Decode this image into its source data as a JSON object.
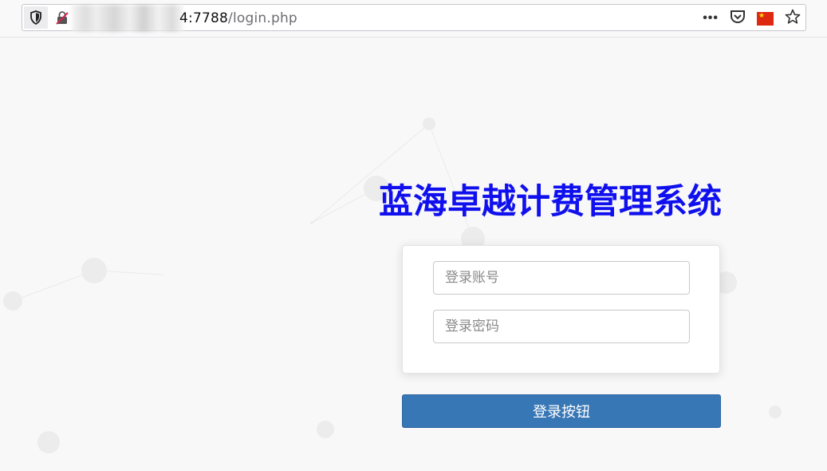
{
  "browser": {
    "url_visible": "4:7788/login.php",
    "url_host_tail": "4:7788",
    "url_path": "/login.php",
    "icons": [
      "shield-icon",
      "lock-icon",
      "more-icon",
      "pocket-icon",
      "flag-icon",
      "star-icon"
    ]
  },
  "page": {
    "title": "蓝海卓越计费管理系统",
    "account_placeholder": "登录账号",
    "password_placeholder": "登录密码",
    "login_button_label": "登录按钮"
  },
  "colors": {
    "title": "#1010ee",
    "button": "#3877b5",
    "background": "#f8f8f9"
  }
}
